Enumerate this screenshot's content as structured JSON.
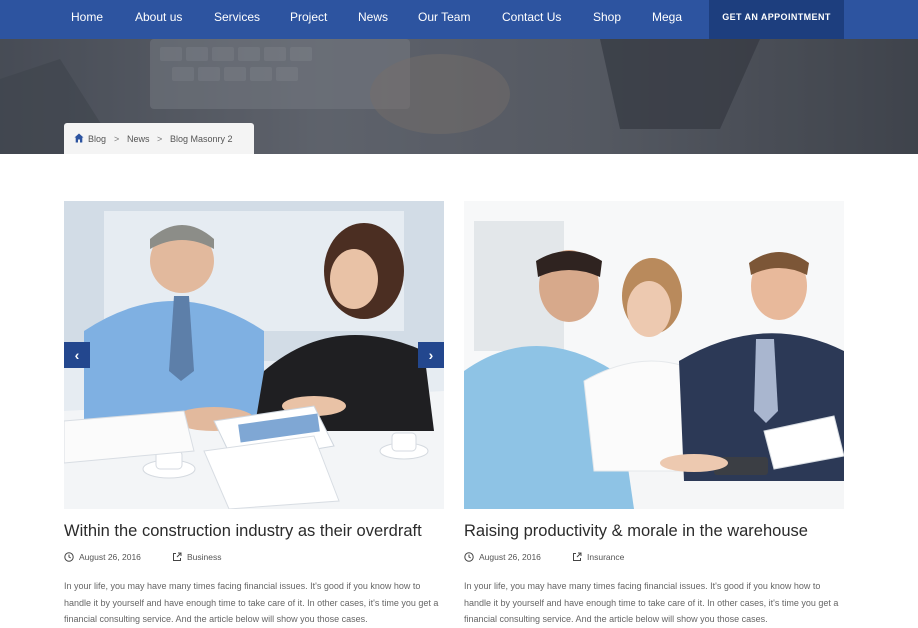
{
  "nav": {
    "items": [
      "Home",
      "About us",
      "Services",
      "Project",
      "News",
      "Our Team",
      "Contact Us",
      "Shop",
      "Mega"
    ],
    "cta": "GET AN APPOINTMENT"
  },
  "breadcrumb": {
    "items": [
      "Blog",
      "News",
      "Blog Masonry 2"
    ]
  },
  "posts": [
    {
      "title": "Within the construction industry as their overdraft",
      "date": "August 26, 2016",
      "category": "Business",
      "excerpt": "In your life, you may have many times facing financial issues. It's good if you know how to handle it by yourself and have enough time to take care of it. In other cases, it's time you get a financial consulting service. And the article below will show you those cases."
    },
    {
      "title": "Raising productivity & morale in the warehouse",
      "date": "August 26, 2016",
      "category": "Insurance",
      "excerpt": "In your life, you may have many times facing financial issues. It's good if you know how to handle it by yourself and have enough time to take care of it. In other cases, it's time you get a financial consulting service. And the article below will show you those cases."
    }
  ],
  "slider": {
    "prev_glyph": "‹",
    "next_glyph": "›"
  },
  "colors": {
    "nav_bg": "#2d54a0",
    "cta_bg": "#1d3e7e",
    "arrow_bg": "#23478e"
  }
}
